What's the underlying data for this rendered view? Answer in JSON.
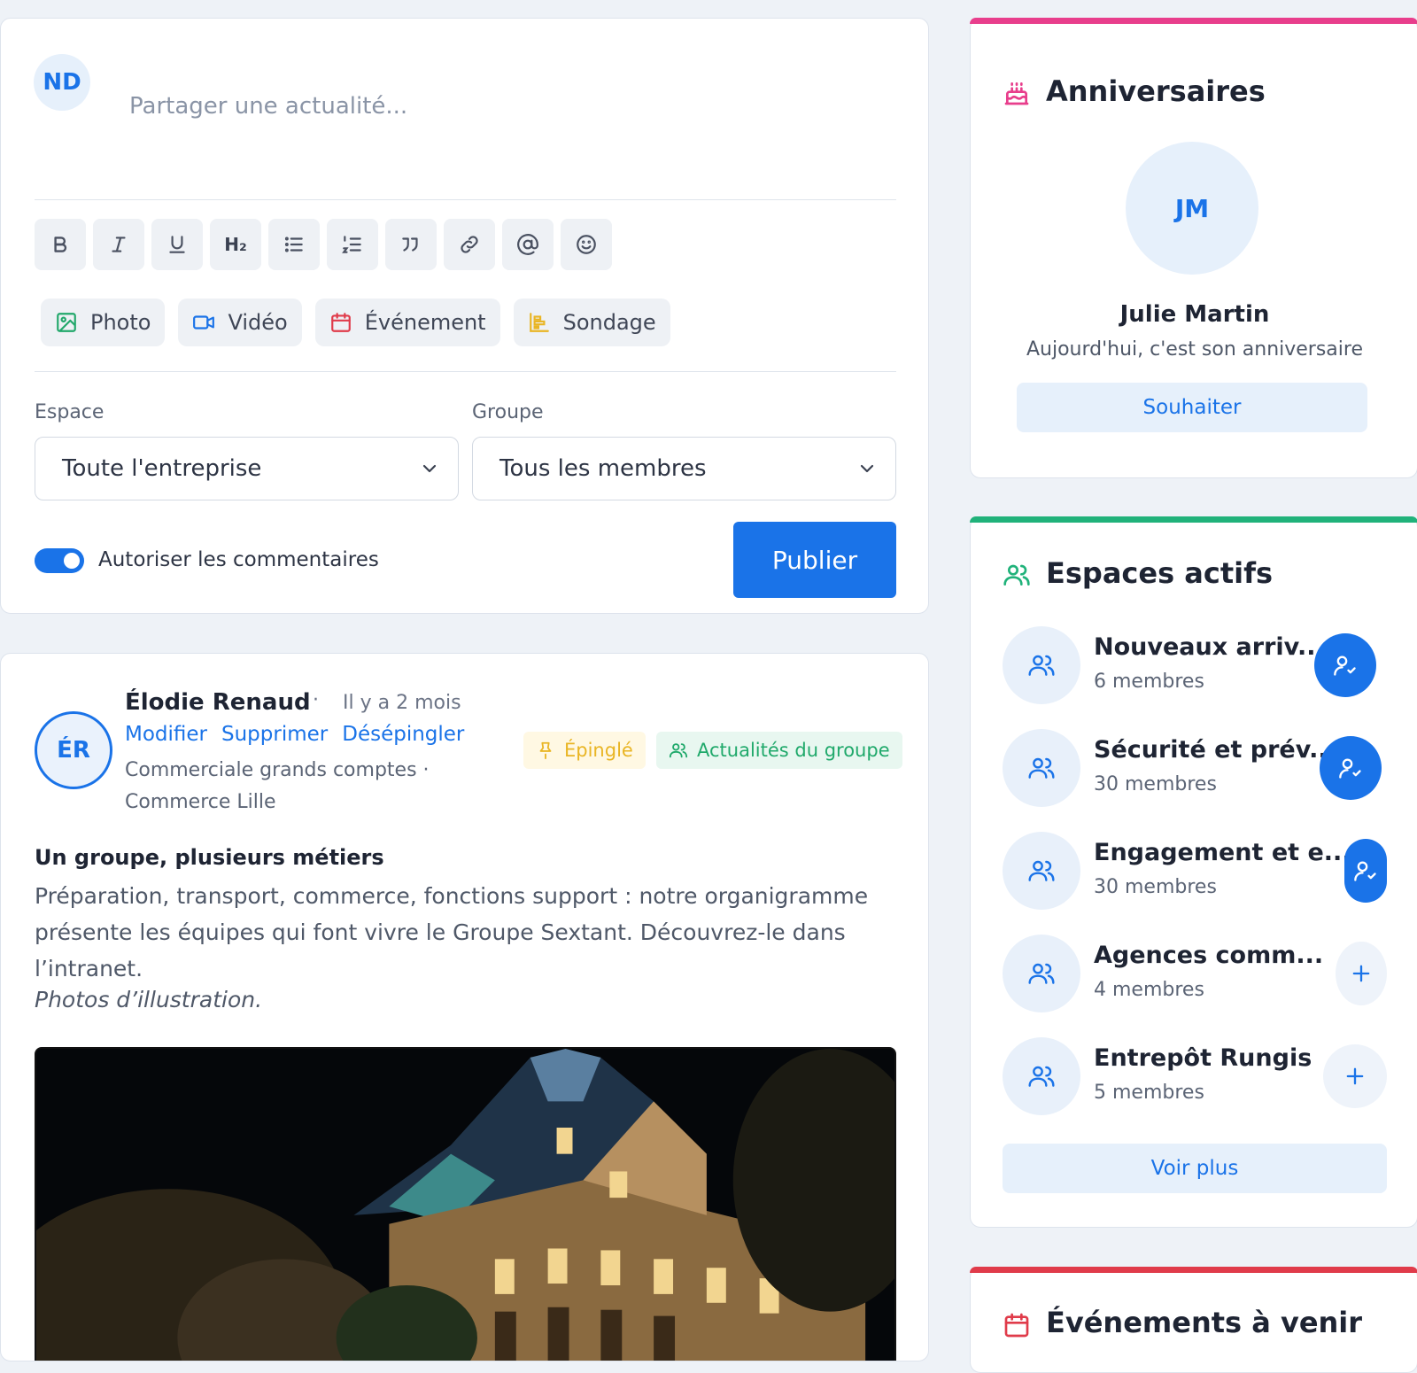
{
  "composer": {
    "avatar_initials": "ND",
    "placeholder": "Partager une actualité...",
    "toolbar": {
      "heading_label": "H₂"
    },
    "attachments": [
      {
        "label": "Photo",
        "icon": "image-icon",
        "color": "#22a86b"
      },
      {
        "label": "Vidéo",
        "icon": "video-icon",
        "color": "#1a73e8"
      },
      {
        "label": "Événement",
        "icon": "calendar-icon",
        "color": "#e03b4a"
      },
      {
        "label": "Sondage",
        "icon": "poll-icon",
        "color": "#e9b524"
      }
    ],
    "space_label": "Espace",
    "space_value": "Toute l'entreprise",
    "group_label": "Groupe",
    "group_value": "Tous les membres",
    "allow_comments_label": "Autoriser les commentaires",
    "allow_comments": true,
    "publish_label": "Publier"
  },
  "post": {
    "avatar_initials": "ÉR",
    "author": "Élodie Renaud",
    "separator": "·",
    "time": "Il y a 2 mois",
    "actions": [
      "Modifier",
      "Supprimer",
      "Désépingler"
    ],
    "role": "Commerciale grands comptes · Commerce Lille",
    "pinned_label": "Épinglé",
    "group_news_label": "Actualités du groupe",
    "title": "Un groupe, plusieurs métiers",
    "body": "Préparation, transport, commerce, fonctions support : notre organigramme présente les équipes qui font vivre le Groupe Sextant. Découvrez-le dans l’intranet.",
    "note": "Photos d’illustration."
  },
  "birthdays": {
    "title": "Anniversaires",
    "accent": "#e83e8c",
    "avatar_initials": "JM",
    "name": "Julie Martin",
    "text": "Aujourd'hui, c'est son anniversaire",
    "wish_label": "Souhaiter"
  },
  "spaces": {
    "title": "Espaces actifs",
    "accent": "#20b27a",
    "items": [
      {
        "name": "Nouveaux arriv...",
        "count": "6 membres",
        "joined": true
      },
      {
        "name": "Sécurité et prév...",
        "count": "30 membres",
        "joined": true
      },
      {
        "name": "Engagement et e...",
        "count": "30 membres",
        "joined": true
      },
      {
        "name": "Agences comm...",
        "count": "4 membres",
        "joined": false
      },
      {
        "name": "Entrepôt Rungis",
        "count": "5 membres",
        "joined": false
      }
    ],
    "see_more_label": "Voir plus"
  },
  "events": {
    "title": "Événements à venir",
    "accent": "#e03b4a"
  },
  "colors": {
    "primary": "#1a73e8",
    "background": "#eef2f7"
  }
}
